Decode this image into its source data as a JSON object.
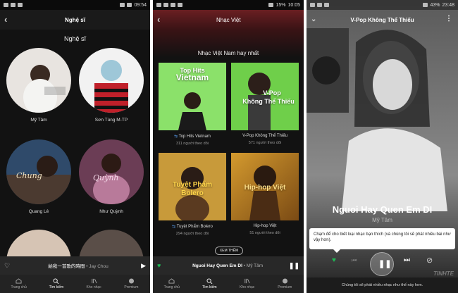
{
  "panel1": {
    "status": {
      "time": "09:54",
      "battery": "",
      "signal": ""
    },
    "header_title": "Nghệ sĩ",
    "section_title": "Nghệ sĩ",
    "artists": [
      "Mỹ Tâm",
      "Sơn Tùng M-TP",
      "Quang Lê",
      "Như Quỳnh"
    ],
    "miniplayer": {
      "track": "給我一首歌的時間",
      "sep": " • ",
      "artist": "Jay Chou"
    },
    "tabs": [
      "Trang chủ",
      "Tìm kiếm",
      "Kho nhạc",
      "Premium"
    ]
  },
  "panel2": {
    "status": {
      "time": "10:05",
      "battery": "15%"
    },
    "header_title": "Nhạc Việt",
    "section_title": "Nhạc Việt Nam hay nhất",
    "playlists": [
      {
        "cover_title_1": "Top Hits",
        "cover_title_2": "Vietnam",
        "name": "Top Hits Vietnam",
        "followers": "311 người theo dõi"
      },
      {
        "cover_title_1": "V-Pop",
        "cover_title_2": "Không Thể Thiếu",
        "name": "V-Pop Không Thể Thiếu",
        "followers": "571 người theo dõi"
      },
      {
        "cover_title_1": "Tuyệt Phẩm",
        "cover_title_2": "Bolero",
        "name": "Tuyệt Phẩm Bolero",
        "followers": "294 người theo dõi"
      },
      {
        "cover_title_1": "Hip-hop Việt",
        "cover_title_2": "",
        "name": "Hip-hop Việt",
        "followers": "51 người theo dõi"
      }
    ],
    "more_label": "XEM THÊM",
    "miniplayer": {
      "track": "Nguoi Hay Quen Em DI",
      "sep": " • ",
      "artist": "Mỹ Tâm"
    },
    "tabs": [
      "Trang chủ",
      "Tìm kiếm",
      "Kho nhạc",
      "Premium"
    ]
  },
  "panel3": {
    "status": {
      "time": "23:48",
      "battery": "43%"
    },
    "header_title": "V-Pop Không Thể Thiếu",
    "track_title": "Nguoi Hay Quen Em DI",
    "track_artist": "Mỹ Tâm",
    "tooltip": "Chạm để cho biết loại nhạc bạn thích (và chúng tôi sẽ phát nhiều bài như vậy hơn).",
    "watermark": "TINHTE",
    "footer_message": "Chúng tôi sẽ phát nhiều nhạc như thế này hơn."
  },
  "colors": {
    "accent": "#1db954",
    "background": "#121212",
    "card_green": "#6fcf4a",
    "card_gold": "#d49a2e"
  }
}
